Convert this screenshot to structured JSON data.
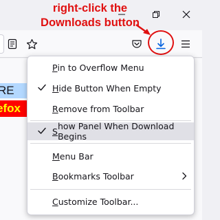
{
  "annotation": {
    "text": "right-click the Downloads button",
    "color": "#e01010"
  },
  "window_controls": {
    "minimize": "minimize-icon",
    "maximize": "restore-icon",
    "close": "close-icon"
  },
  "toolbar": {
    "icons": [
      "reader-view-icon",
      "bookmark-star-icon",
      "pocket-icon",
      "downloads-icon",
      "hamburger-menu-icon"
    ],
    "download_accent": "#0060df"
  },
  "page_fragments": {
    "line1": "RE",
    "line2": "efox"
  },
  "context_menu": {
    "items": [
      {
        "key": "P",
        "rest": "in to Overflow Menu",
        "checked": false
      },
      {
        "key": "H",
        "rest": "ide Button When Empty",
        "checked": true
      },
      {
        "key": "R",
        "rest": "emove from Toolbar",
        "checked": false
      },
      {
        "key": "S",
        "rest": "how Panel When Download Begins",
        "checked": true,
        "hovered": true
      },
      {
        "key": "M",
        "rest": "enu Bar",
        "checked": false
      },
      {
        "key": "B",
        "rest": "ookmarks Toolbar",
        "checked": false,
        "submenu": true
      },
      {
        "key": "C",
        "rest": "ustomize Toolbar...",
        "checked": false
      }
    ]
  }
}
